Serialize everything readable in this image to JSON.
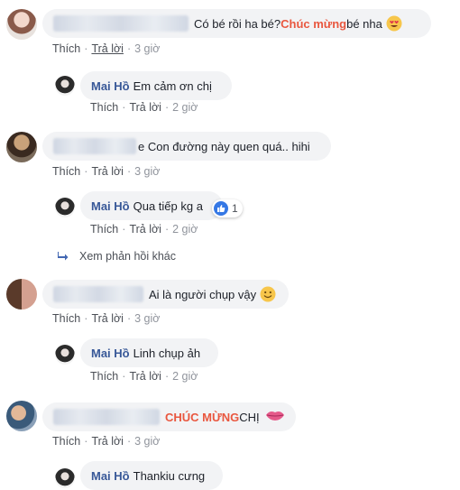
{
  "comments": [
    {
      "text_pre": "Có bé rồi ha bé? ",
      "text_hl": "Chúc mừng",
      "text_post": " bé nha",
      "emoji": "heart-eyes-emoji",
      "actions": {
        "like": "Thích",
        "reply": "Trả lời",
        "time": "3 giờ"
      },
      "reply": {
        "author": "Mai Hồ",
        "text": "Em cảm ơn chị",
        "actions": {
          "like": "Thích",
          "reply": "Trả lời",
          "time": "2 giờ"
        }
      }
    },
    {
      "text_pre": "e Con đường này quen quá.. hihi",
      "actions": {
        "like": "Thích",
        "reply": "Trả lời",
        "time": "3 giờ"
      },
      "reply": {
        "author": "Mai Hồ",
        "text": "Qua tiếp kg a",
        "reaction_count": "1",
        "actions": {
          "like": "Thích",
          "reply": "Trả lời",
          "time": "2 giờ"
        }
      },
      "more_replies": "Xem phản hồi khác"
    },
    {
      "text_pre": "Ai là người chụp vậy",
      "emoji": "smile-emoji",
      "actions": {
        "like": "Thích",
        "reply": "Trả lời",
        "time": "3 giờ"
      },
      "reply": {
        "author": "Mai Hồ",
        "text": "Linh chụp ảh",
        "actions": {
          "like": "Thích",
          "reply": "Trả lời",
          "time": "2 giờ"
        }
      }
    },
    {
      "text_hl": "CHÚC MỪNG",
      "text_post": " CHỊ",
      "emoji": "kiss-lips-emoji",
      "actions": {
        "like": "Thích",
        "reply": "Trả lời",
        "time": "3 giờ"
      },
      "reply": {
        "author": "Mai Hồ",
        "text": "Thankiu cưng"
      }
    }
  ],
  "colors": {
    "name": "#385898",
    "highlight": "#e9573f",
    "bubble": "#f2f3f5",
    "like_blue": "#3578e5"
  }
}
